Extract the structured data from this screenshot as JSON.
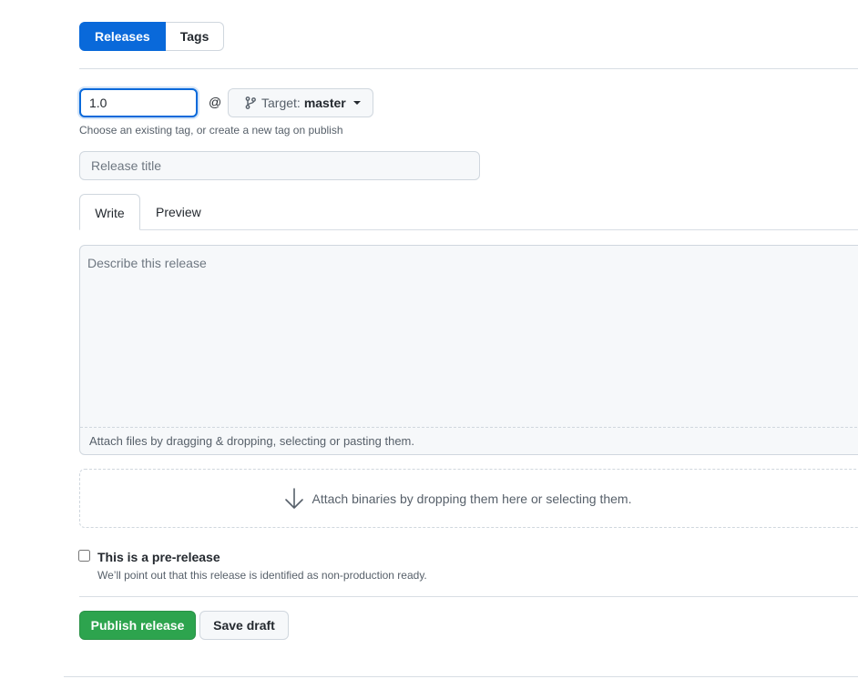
{
  "subnav": {
    "releases_label": "Releases",
    "tags_label": "Tags"
  },
  "tag": {
    "value": "1.0",
    "at": "@",
    "target_prefix": "Target:",
    "target_branch": "master",
    "hint": "Choose an existing tag, or create a new tag on publish"
  },
  "release_title": {
    "placeholder": "Release title"
  },
  "tabs": {
    "write": "Write",
    "preview": "Preview"
  },
  "description": {
    "placeholder": "Describe this release",
    "attach_hint": "Attach files by dragging & dropping, selecting or pasting them."
  },
  "binaries": {
    "label": "Attach binaries by dropping them here or selecting them."
  },
  "prerelease": {
    "label": "This is a pre-release",
    "note": "We’ll point out that this release is identified as non-production ready."
  },
  "actions": {
    "publish_label": "Publish release",
    "draft_label": "Save draft"
  },
  "colors": {
    "accent": "#0969da",
    "publish": "#2da44e"
  },
  "icons": {
    "target": "git-branch-icon",
    "binaries": "arrow-down-icon"
  }
}
